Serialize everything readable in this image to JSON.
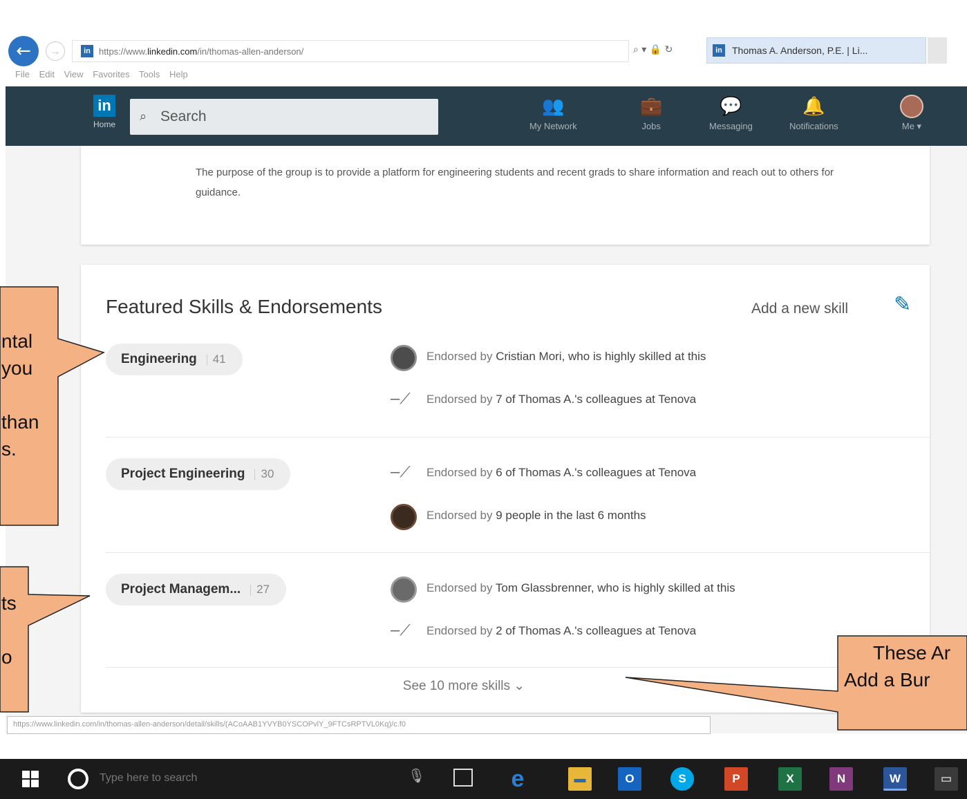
{
  "browser": {
    "url": "https://www.linkedin.com/in/thomas-allen-anderson/",
    "url_prefix": "https://www.",
    "url_domain": "linkedin.com",
    "url_path": "/in/thomas-allen-anderson/",
    "address_icons": "⌕ ▾ 🔒 ↻",
    "tab_title": "Thomas A. Anderson, P.E. | Li...",
    "menu": [
      "File",
      "Edit",
      "View",
      "Favorites",
      "Tools",
      "Help"
    ],
    "back_icon": "arrow-left-icon",
    "status_url": "https://www.linkedin.com/in/thomas-allen-anderson/detail/skills/(ACoAAB1YVYB0YSCOPvlY_9FTCsRPTVL0Kq)/c.f0"
  },
  "nav": {
    "logo": "in",
    "home_label": "Home",
    "search_placeholder": "Search",
    "items": [
      {
        "icon": "👥",
        "label": "My Network"
      },
      {
        "icon": "💼",
        "label": "Jobs"
      },
      {
        "icon": "💬",
        "label": "Messaging"
      },
      {
        "icon": "🔔",
        "label": "Notifications"
      },
      {
        "icon": "avatar",
        "label": "Me ▾"
      }
    ]
  },
  "about": {
    "text": "The purpose of the group is to provide a platform for engineering students and recent grads to share information and reach out to others for guidance."
  },
  "skills": {
    "title": "Featured Skills & Endorsements",
    "add_label": "Add a new skill",
    "edit_icon": "pencil-icon",
    "see_more": "See 10 more skills ⌄",
    "items": [
      {
        "name": "Engineering",
        "count": "41",
        "endorsements": [
          {
            "prefix": "Endorsed by ",
            "bold": "Cristian Mori, who is highly skilled at this",
            "icon": "avatar"
          },
          {
            "prefix": "Endorsed by ",
            "bold": "7 of Thomas A.'s colleagues at Tenova",
            "icon": "colleagues"
          }
        ]
      },
      {
        "name": "Project Engineering",
        "count": "30",
        "endorsements": [
          {
            "prefix": "Endorsed by ",
            "bold": "6 of Thomas A.'s colleagues at Tenova",
            "icon": "colleagues"
          },
          {
            "prefix": "Endorsed by ",
            "bold": "9 people in the last 6 months",
            "icon": "avatar"
          }
        ]
      },
      {
        "name": "Project Managem...",
        "count": "27",
        "endorsements": [
          {
            "prefix": "Endorsed by ",
            "bold": "Tom Glassbrenner, who is highly skilled at this",
            "icon": "avatar"
          },
          {
            "prefix": "Endorsed by ",
            "bold": "2 of Thomas A.'s colleagues at Tenova",
            "icon": "colleagues"
          }
        ]
      }
    ]
  },
  "callouts": {
    "left_top": [
      "ntal",
      "you",
      "",
      "than",
      "s."
    ],
    "left_bottom": [
      "ts",
      "",
      "o"
    ],
    "right": [
      "These Ar",
      "Add a Bur"
    ]
  },
  "taskbar": {
    "search_placeholder": "Type here to search",
    "apps": [
      {
        "name": "edge",
        "glyph": "e",
        "color": "#2a7fd4"
      },
      {
        "name": "file-explorer",
        "glyph": "▬",
        "color": "#e8b73a"
      },
      {
        "name": "outlook",
        "glyph": "O",
        "color": "#1565c0"
      },
      {
        "name": "skype",
        "glyph": "S",
        "color": "#00a8e8"
      },
      {
        "name": "powerpoint",
        "glyph": "P",
        "color": "#d24726"
      },
      {
        "name": "excel",
        "glyph": "X",
        "color": "#1f7244"
      },
      {
        "name": "onenote",
        "glyph": "N",
        "color": "#80397b"
      },
      {
        "name": "word",
        "glyph": "W",
        "color": "#2b579a"
      },
      {
        "name": "desktop",
        "glyph": "▭",
        "color": "#3a3a3a"
      }
    ]
  },
  "colors": {
    "nav_bg": "#283e4a",
    "linkedin_blue": "#0077b5",
    "callout_fill": "#f4b183",
    "taskbar_bg": "#1b1b1b"
  }
}
